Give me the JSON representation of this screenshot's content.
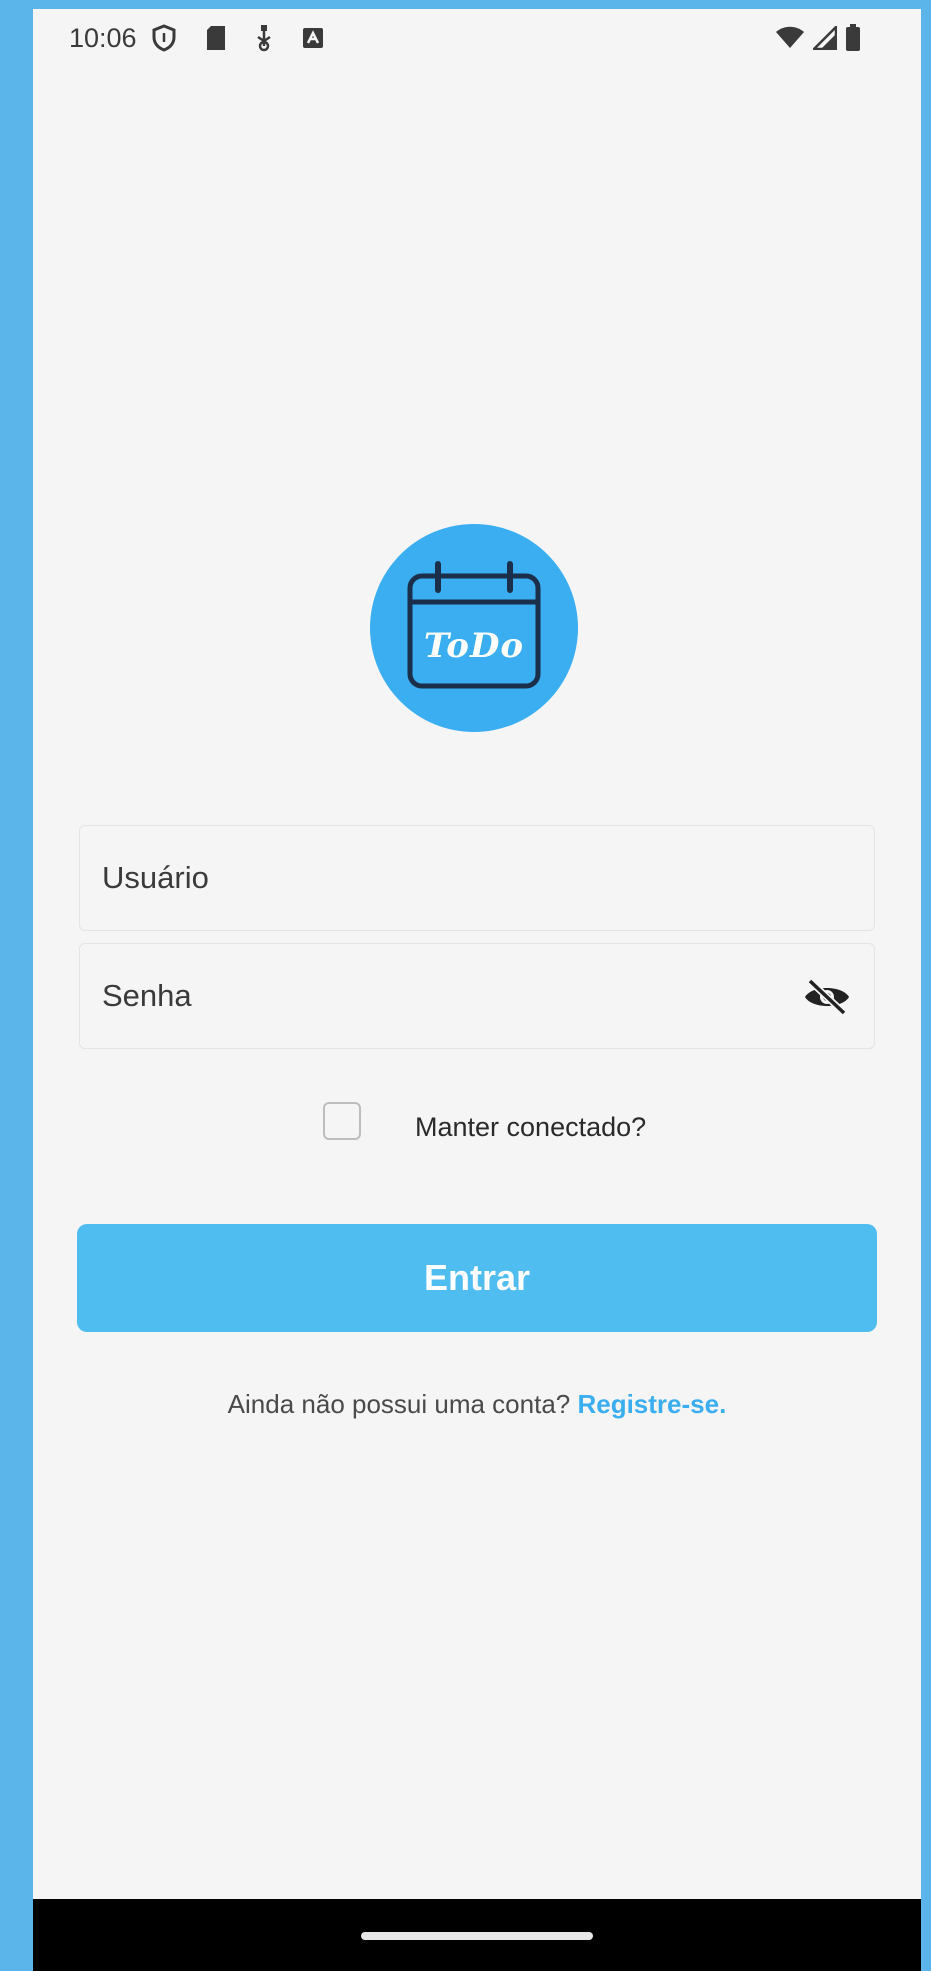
{
  "status_bar": {
    "time": "10:06",
    "left_icons": [
      "vpn-shield-icon",
      "sd-card-icon",
      "usb-icon",
      "notification-app-icon"
    ],
    "right_icons": [
      "wifi-icon",
      "cellular-signal-icon",
      "battery-icon"
    ]
  },
  "logo": {
    "text": "ToDo",
    "icon": "calendar-icon",
    "color": "#3AAEF0"
  },
  "form": {
    "username_placeholder": "Usuário",
    "username_value": "",
    "password_placeholder": "Senha",
    "password_value": "",
    "password_toggle_icon": "eye-off-icon",
    "remember_label": "Manter conectado?",
    "remember_checked": false,
    "submit_label": "Entrar"
  },
  "register": {
    "prompt": "Ainda não possui uma conta?",
    "link_label": "Registre-se."
  },
  "colors": {
    "accent": "#50BDF0",
    "link": "#3AAEF0",
    "frame": "#5BB5EA",
    "background": "#F5F5F5"
  }
}
